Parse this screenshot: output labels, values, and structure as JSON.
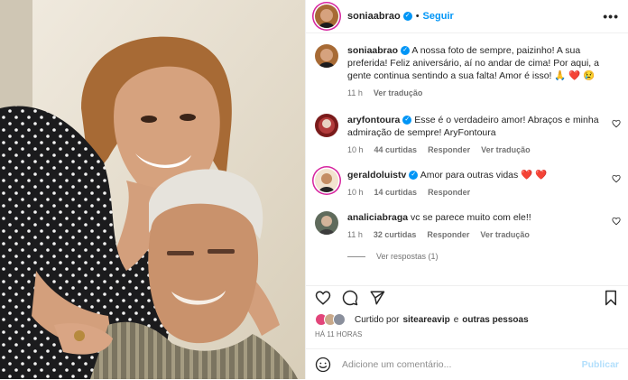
{
  "post": {
    "username": "soniaabrao",
    "follow_label": "Seguir",
    "more_label": "•••",
    "dot": "•",
    "photo_alt": "Foto de Sonia Abrão com o pai"
  },
  "caption": {
    "username": "soniaabrao",
    "text": "A nossa foto de sempre, paizinho! A sua preferida! Feliz aniversário, aí no andar de cima! Por aqui, a gente continua sentindo a sua falta! Amor é isso! 🙏 ❤️ 😢",
    "time": "11 h",
    "translate": "Ver tradução"
  },
  "comments": [
    {
      "username": "aryfontoura",
      "verified": true,
      "text": "Esse é o verdadeiro amor! Abraços e minha admiração de sempre! AryFontoura",
      "time": "10 h",
      "likes": "44 curtidas",
      "reply": "Responder",
      "translate": "Ver tradução"
    },
    {
      "username": "geraldoluistv",
      "verified": true,
      "text": "Amor para outras vidas ❤️ ❤️",
      "time": "10 h",
      "likes": "14 curtidas",
      "reply": "Responder",
      "translate": ""
    },
    {
      "username": "analiciabraga",
      "verified": false,
      "text": "vc se parece muito com ele!!",
      "time": "11 h",
      "likes": "32 curtidas",
      "reply": "Responder",
      "translate": "Ver tradução"
    }
  ],
  "view_replies": "Ver respostas (1)",
  "liked_by": {
    "prefix": "Curtido por",
    "user": "siteareavip",
    "and": "e",
    "others": "outras pessoas"
  },
  "ago": "HÁ 11 HORAS",
  "comment_input": {
    "placeholder": "Adicione um comentário...",
    "publish": "Publicar"
  },
  "colors": {
    "accent_blue": "#0095f6",
    "heart_red": "#ed4956",
    "muted": "#737373"
  }
}
